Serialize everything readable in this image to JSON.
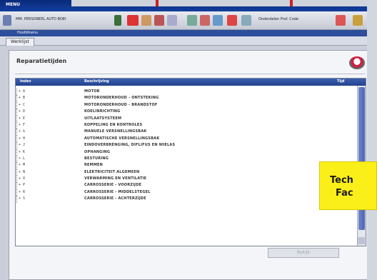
{
  "window": {
    "title_label": "MENU"
  },
  "toolbar": {
    "left_text": "MM. PERSONEEL AUTO BOEI",
    "right_text": "Onderdelen Prof. Code"
  },
  "menu": {
    "label": "Hoofdmenu"
  },
  "tab": {
    "label": "Werklijst"
  },
  "panel": {
    "title": "Reparatietijden"
  },
  "table": {
    "headers": {
      "code": "Index",
      "desc": "Beschrijving",
      "extra": "Tijd"
    },
    "rows": [
      {
        "code": "+ A",
        "desc": "MOTOR"
      },
      {
        "code": "+ B",
        "desc": "MOTORONDERHOUD - ONTSTEKING"
      },
      {
        "code": "+ C",
        "desc": "MOTORONDERHOUD - BRANDSTOF"
      },
      {
        "code": "+ D",
        "desc": "KOELINRICHTING"
      },
      {
        "code": "+ E",
        "desc": "UITLAATSYSTEEM"
      },
      {
        "code": "+ F",
        "desc": "KOPPELING EN KONTROLES"
      },
      {
        "code": "+ G",
        "desc": "MANUELE VERSNELLINGSBAK"
      },
      {
        "code": "+ H",
        "desc": "AUTOMATISCHE VERSNELLINGSBAK"
      },
      {
        "code": "+ J",
        "desc": "EINDOVERBRENGING, DIFLIFUS EN WIELAS"
      },
      {
        "code": "+ K",
        "desc": "OPHANGING"
      },
      {
        "code": "+ L",
        "desc": "BESTURING"
      },
      {
        "code": "+ M",
        "desc": "REMMEN"
      },
      {
        "code": "+ N",
        "desc": "ELEKTRICITEIT ALGEMEEN"
      },
      {
        "code": "+ O",
        "desc": "VERWARMING EN VENTILATIE"
      },
      {
        "code": "+ P",
        "desc": "CARROSSERIE - VOORZIJDE"
      },
      {
        "code": "+ R",
        "desc": "CARROSSERIE - MIDDELSTEGEL"
      },
      {
        "code": "+ S",
        "desc": "CARROSSERIE - ACHTERZIJDE"
      }
    ]
  },
  "buttons": {
    "ok_label": "Bekijk"
  },
  "callout": {
    "line1": "Tech",
    "line2": "Fac"
  },
  "colors": {
    "callout_bg": "#fbef1a",
    "header_blue": "#23428c"
  }
}
